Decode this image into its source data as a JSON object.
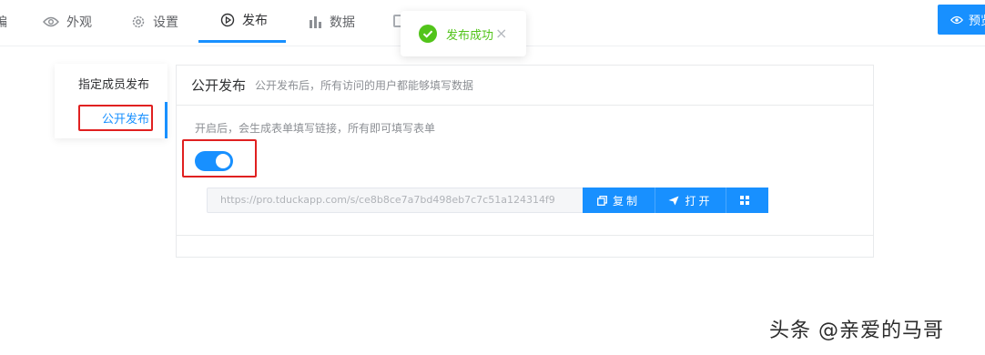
{
  "topnav": {
    "clipped_item": "编辑",
    "items": [
      {
        "label": "外观",
        "icon": "eye-icon",
        "active": false
      },
      {
        "label": "设置",
        "icon": "gear-icon",
        "active": false
      },
      {
        "label": "发布",
        "icon": "play-circle-icon",
        "active": true
      },
      {
        "label": "数据",
        "icon": "bar-chart-icon",
        "active": false
      }
    ],
    "preview_label": "预览",
    "accent": "#1890ff"
  },
  "toast": {
    "message": "发布成功",
    "close": "×",
    "color": "#52c41a"
  },
  "sidemenu": {
    "items": [
      {
        "label": "指定成员发布",
        "active": false
      },
      {
        "label": "公开发布",
        "active": true
      }
    ]
  },
  "card": {
    "title": "公开发布",
    "subtitle": "公开发布后，所有访问的用户都能够填写数据",
    "description": "开启后，会生成表单填写链接，所有即可填写表单",
    "switch_on": true,
    "url": "https://pro.tduckapp.com/s/ce8b8ce7a7bd498eb7c7c51a124314f9",
    "buttons": {
      "copy": "复制",
      "open": "打开",
      "qrcode_icon": "qrcode-icon"
    }
  },
  "watermark": "头条 @亲爱的马哥"
}
